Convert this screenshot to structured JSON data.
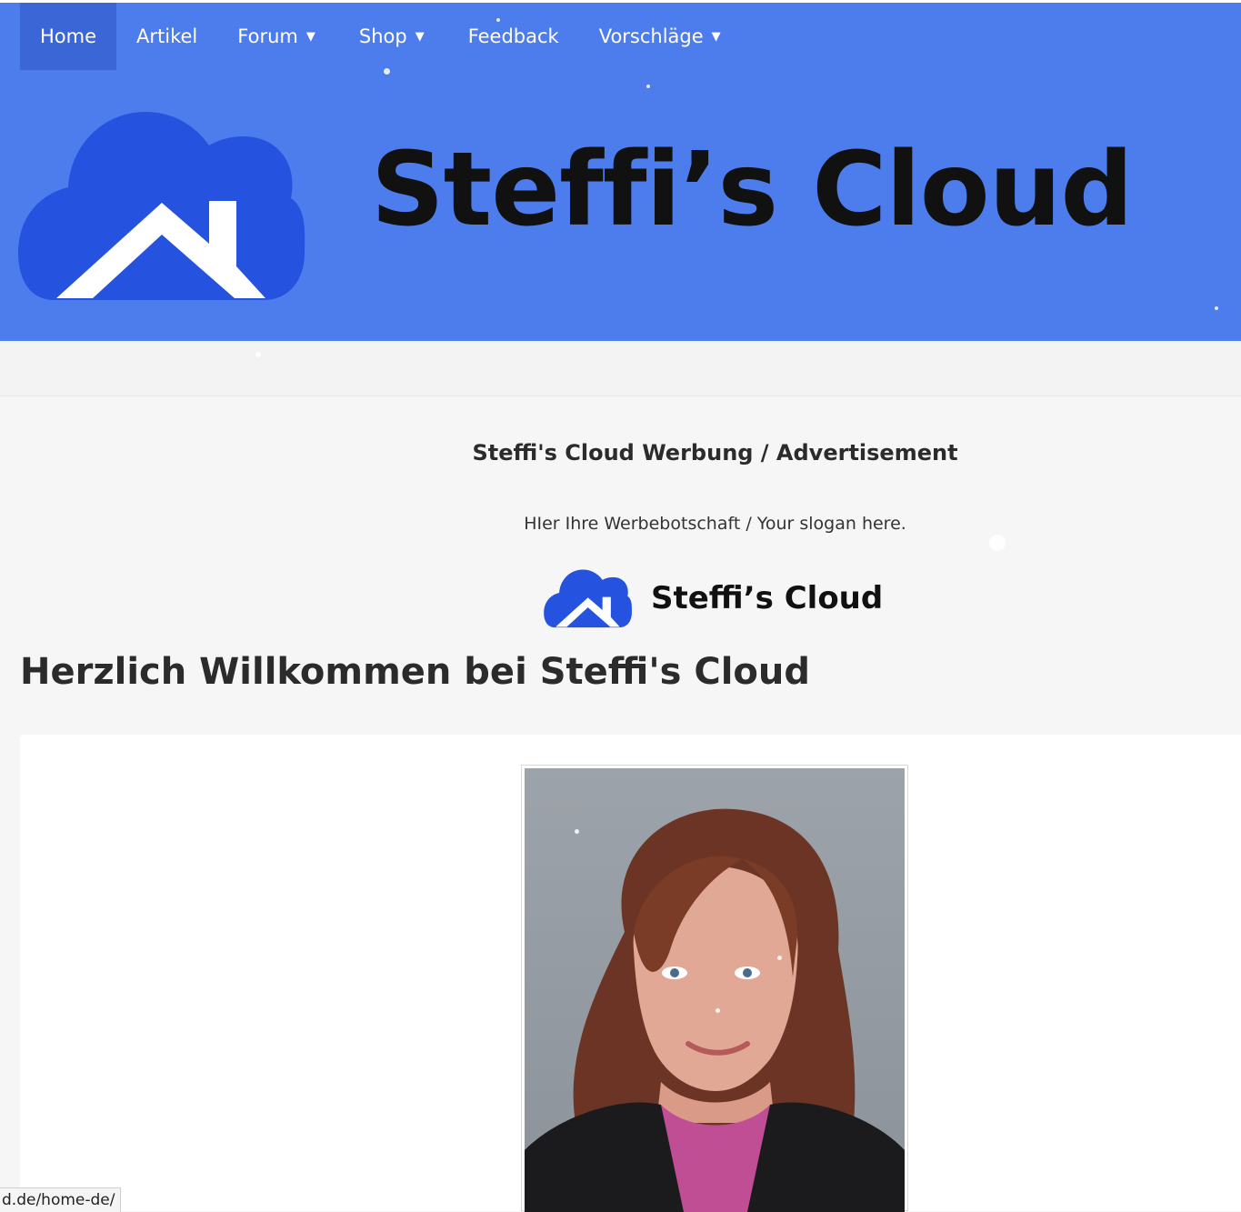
{
  "nav": {
    "items": [
      {
        "label": "Home",
        "active": true,
        "dropdown": false
      },
      {
        "label": "Artikel",
        "active": false,
        "dropdown": false
      },
      {
        "label": "Forum",
        "active": false,
        "dropdown": true
      },
      {
        "label": "Shop",
        "active": false,
        "dropdown": true
      },
      {
        "label": "Feedback",
        "active": false,
        "dropdown": false
      },
      {
        "label": "Vorschläge",
        "active": false,
        "dropdown": true
      }
    ],
    "caret_icon": "caret-down-icon"
  },
  "header": {
    "site_title": "Steffi’s Cloud",
    "logo_icon": "cloud-house-icon",
    "background_color": "#4d7ded",
    "cloud_color": "#2552de"
  },
  "ad": {
    "title": "Steffi's Cloud Werbung / Advertisement",
    "slogan": "HIer Ihre Werbebotschaft / Your slogan here.",
    "logo_text": "Steffi’s Cloud"
  },
  "main": {
    "welcome_heading": "Herzlich Willkommen bei Steffi's Cloud",
    "photo_icon": "portrait-photo"
  },
  "status_bar": {
    "url": "d.de/home-de/"
  }
}
